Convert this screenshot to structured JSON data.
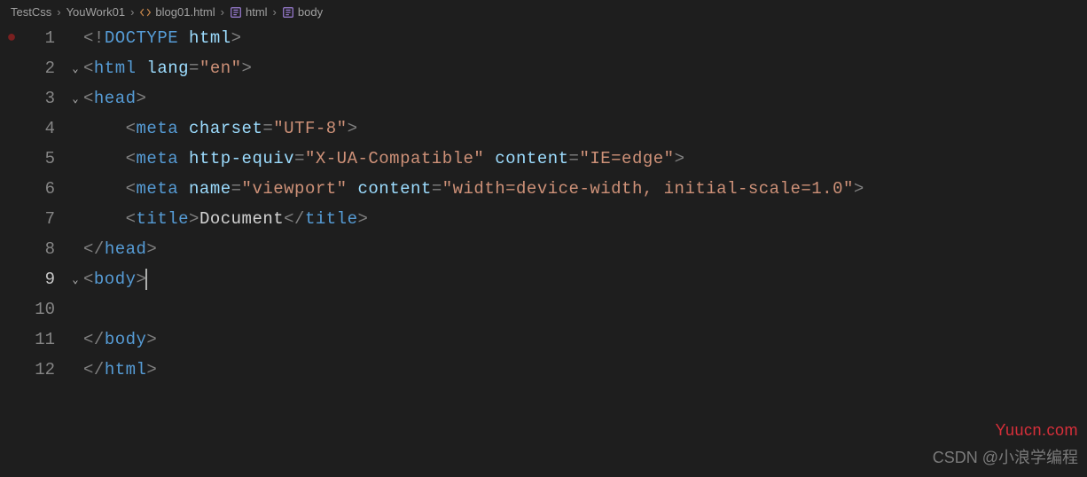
{
  "breadcrumb": {
    "items": [
      "TestCss",
      "YouWork01",
      "blog01.html",
      "html",
      "body"
    ],
    "sep": "›"
  },
  "lines": [
    {
      "num": "1",
      "fold": "",
      "dot": true,
      "tokens": [
        [
          "punct",
          "<!"
        ],
        [
          "tag",
          "DOCTYPE"
        ],
        [
          "text",
          " "
        ],
        [
          "attr",
          "html"
        ],
        [
          "punct",
          ">"
        ]
      ]
    },
    {
      "num": "2",
      "fold": "⌄",
      "dot": false,
      "tokens": [
        [
          "punct",
          "<"
        ],
        [
          "tag",
          "html"
        ],
        [
          "text",
          " "
        ],
        [
          "attr",
          "lang"
        ],
        [
          "punct",
          "="
        ],
        [
          "str",
          "\"en\""
        ],
        [
          "punct",
          ">"
        ]
      ]
    },
    {
      "num": "3",
      "fold": "⌄",
      "dot": false,
      "tokens": [
        [
          "punct",
          "<"
        ],
        [
          "tag",
          "head"
        ],
        [
          "punct",
          ">"
        ]
      ]
    },
    {
      "num": "4",
      "fold": "",
      "dot": false,
      "tokens": [
        [
          "text",
          "    "
        ],
        [
          "punct",
          "<"
        ],
        [
          "tag",
          "meta"
        ],
        [
          "text",
          " "
        ],
        [
          "attr",
          "charset"
        ],
        [
          "punct",
          "="
        ],
        [
          "str",
          "\"UTF-8\""
        ],
        [
          "punct",
          ">"
        ]
      ]
    },
    {
      "num": "5",
      "fold": "",
      "dot": false,
      "tokens": [
        [
          "text",
          "    "
        ],
        [
          "punct",
          "<"
        ],
        [
          "tag",
          "meta"
        ],
        [
          "text",
          " "
        ],
        [
          "attr",
          "http-equiv"
        ],
        [
          "punct",
          "="
        ],
        [
          "str",
          "\"X-UA-Compatible\""
        ],
        [
          "text",
          " "
        ],
        [
          "attr",
          "content"
        ],
        [
          "punct",
          "="
        ],
        [
          "str",
          "\"IE=edge\""
        ],
        [
          "punct",
          ">"
        ]
      ]
    },
    {
      "num": "6",
      "fold": "",
      "dot": false,
      "tokens": [
        [
          "text",
          "    "
        ],
        [
          "punct",
          "<"
        ],
        [
          "tag",
          "meta"
        ],
        [
          "text",
          " "
        ],
        [
          "attr",
          "name"
        ],
        [
          "punct",
          "="
        ],
        [
          "str",
          "\"viewport\""
        ],
        [
          "text",
          " "
        ],
        [
          "attr",
          "content"
        ],
        [
          "punct",
          "="
        ],
        [
          "str",
          "\"width=device-width, initial-scale=1.0\""
        ],
        [
          "punct",
          ">"
        ]
      ]
    },
    {
      "num": "7",
      "fold": "",
      "dot": false,
      "tokens": [
        [
          "text",
          "    "
        ],
        [
          "punct",
          "<"
        ],
        [
          "tag",
          "title"
        ],
        [
          "punct",
          ">"
        ],
        [
          "text",
          "Document"
        ],
        [
          "punct",
          "</"
        ],
        [
          "tag",
          "title"
        ],
        [
          "punct",
          ">"
        ]
      ]
    },
    {
      "num": "8",
      "fold": "",
      "dot": false,
      "tokens": [
        [
          "punct",
          "</"
        ],
        [
          "tag",
          "head"
        ],
        [
          "punct",
          ">"
        ]
      ]
    },
    {
      "num": "9",
      "fold": "⌄",
      "dot": false,
      "current": true,
      "cursor": true,
      "tokens": [
        [
          "punct",
          "<"
        ],
        [
          "tag",
          "body"
        ],
        [
          "punct",
          ">"
        ]
      ]
    },
    {
      "num": "10",
      "fold": "",
      "dot": false,
      "tokens": []
    },
    {
      "num": "11",
      "fold": "",
      "dot": false,
      "tokens": [
        [
          "punct",
          "</"
        ],
        [
          "tag",
          "body"
        ],
        [
          "punct",
          ">"
        ]
      ]
    },
    {
      "num": "12",
      "fold": "",
      "dot": false,
      "tokens": [
        [
          "punct",
          "</"
        ],
        [
          "tag",
          "html"
        ],
        [
          "punct",
          ">"
        ]
      ]
    }
  ],
  "watermark1": "Yuucn.com",
  "watermark2": "CSDN @小浪学编程"
}
